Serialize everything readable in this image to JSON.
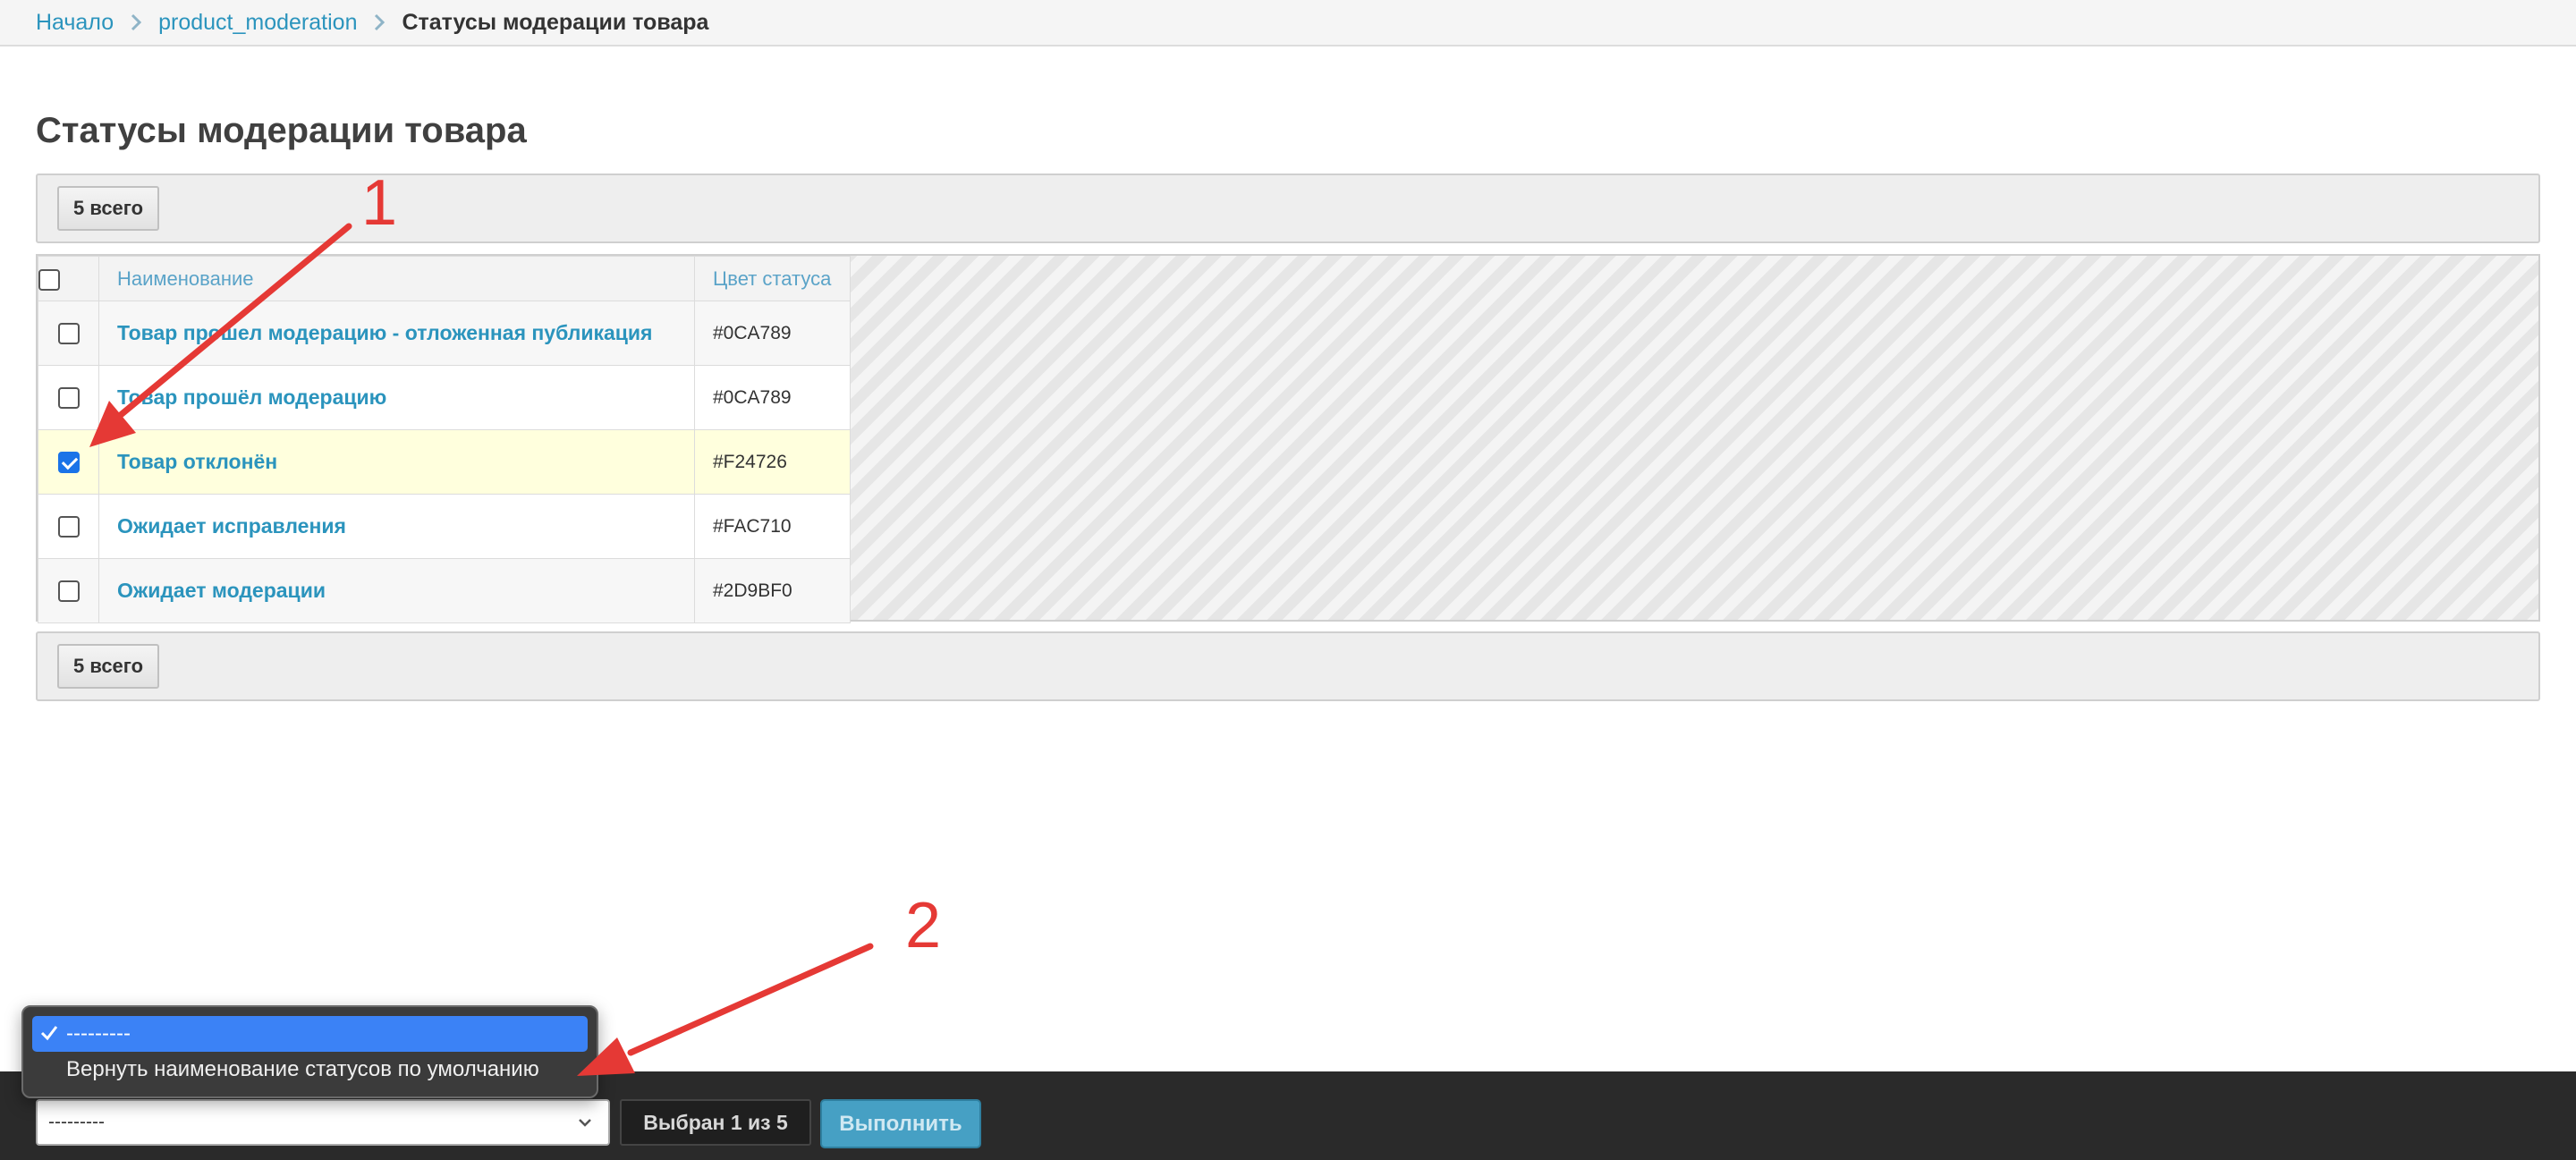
{
  "breadcrumbs": {
    "items": [
      {
        "label": "Начало"
      },
      {
        "label": "product_moderation"
      },
      {
        "label": "Статусы модерации товара"
      }
    ]
  },
  "page": {
    "title": "Статусы модерации товара"
  },
  "paginator": {
    "total_label": "5 всего"
  },
  "table": {
    "columns": [
      "Наименование",
      "Цвет статуса"
    ],
    "rows": [
      {
        "name": "Товар прошел модерацию - отложенная публикация",
        "color": "#0CA789",
        "checked": false
      },
      {
        "name": "Товар прошёл модерацию",
        "color": "#0CA789",
        "checked": false
      },
      {
        "name": "Товар отклонён",
        "color": "#F24726",
        "checked": true
      },
      {
        "name": "Ожидает исправления",
        "color": "#FAC710",
        "checked": false
      },
      {
        "name": "Ожидает модерации",
        "color": "#2D9BF0",
        "checked": false
      }
    ]
  },
  "actions": {
    "select_value": "---------",
    "options": [
      {
        "label": "---------",
        "selected": true
      },
      {
        "label": "Вернуть наименование статусов по умолчанию",
        "selected": false
      }
    ],
    "selected_counter": "Выбран 1 из 5",
    "run_button": "Выполнить"
  },
  "annotations": {
    "marker_1": "1",
    "marker_2": "2",
    "arrow_color": "#e53935"
  },
  "colors": {
    "link": "#2b94bd",
    "selected_row": "#ffffdd",
    "action_bar": "#2a2a2a",
    "run_button": "#46a0c4",
    "dropdown_highlight": "#3b82f6"
  }
}
